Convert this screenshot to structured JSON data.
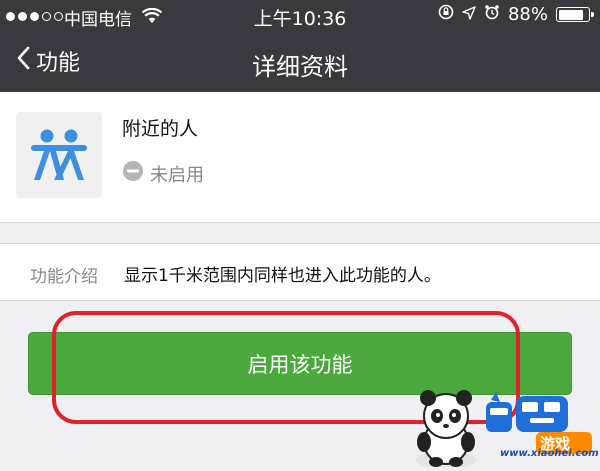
{
  "status_bar": {
    "carrier": "中国电信",
    "time": "上午10:36",
    "battery_text": "88%",
    "battery_level": 0.88,
    "signal_dots_filled": 3,
    "signal_dots_total": 5
  },
  "nav": {
    "back_label": "功能",
    "title": "详细资料"
  },
  "feature": {
    "name": "附近的人",
    "status": "未启用",
    "icon": "people-nearby-icon",
    "icon_color": "#3d8fe0"
  },
  "intro": {
    "label": "功能介绍",
    "text": "显示1千米范围内同样也进入此功能的人。"
  },
  "action": {
    "enable_label": "启用该功能",
    "button_color": "#4aa83c",
    "highlight_color": "#e0222b"
  },
  "watermark": {
    "url": "www.xiaohei.com",
    "logo_text": "小黑游戏"
  }
}
